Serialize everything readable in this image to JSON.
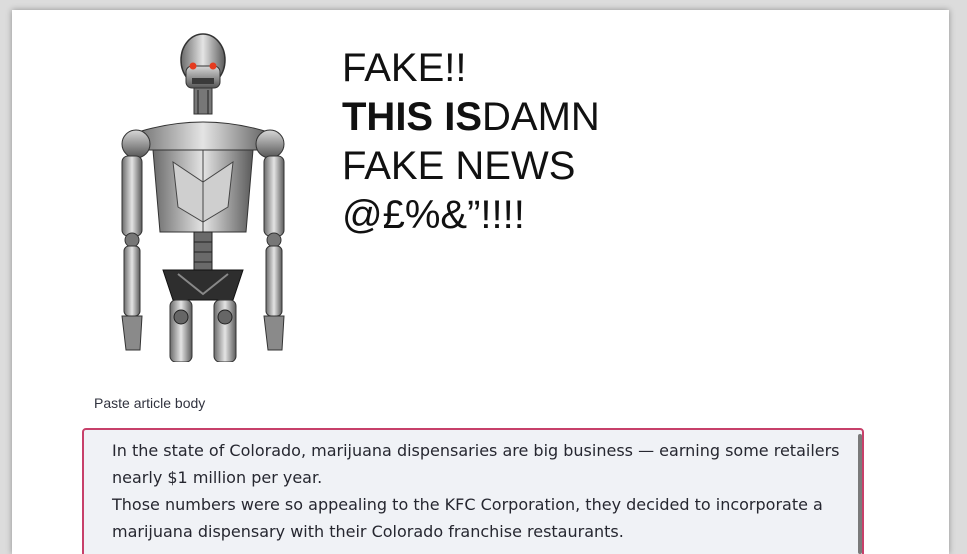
{
  "hero": {
    "slogan": {
      "line1": "FAKE!!",
      "line2_bold": "THIS IS",
      "line2_rest": "DAMN",
      "line3": "FAKE NEWS",
      "line4": "@£%&”!!!!"
    }
  },
  "article_input": {
    "label": "Paste article body",
    "value": "In the state of Colorado, marijuana dispensaries are big business — earning some retailers nearly $1 million per year.\nThose numbers were so appealing to the KFC Corporation, they decided to incorporate a marijuana dispensary with their Colorado franchise restaurants.",
    "focus_color": "#c7406a",
    "background": "#f0f2f6"
  }
}
